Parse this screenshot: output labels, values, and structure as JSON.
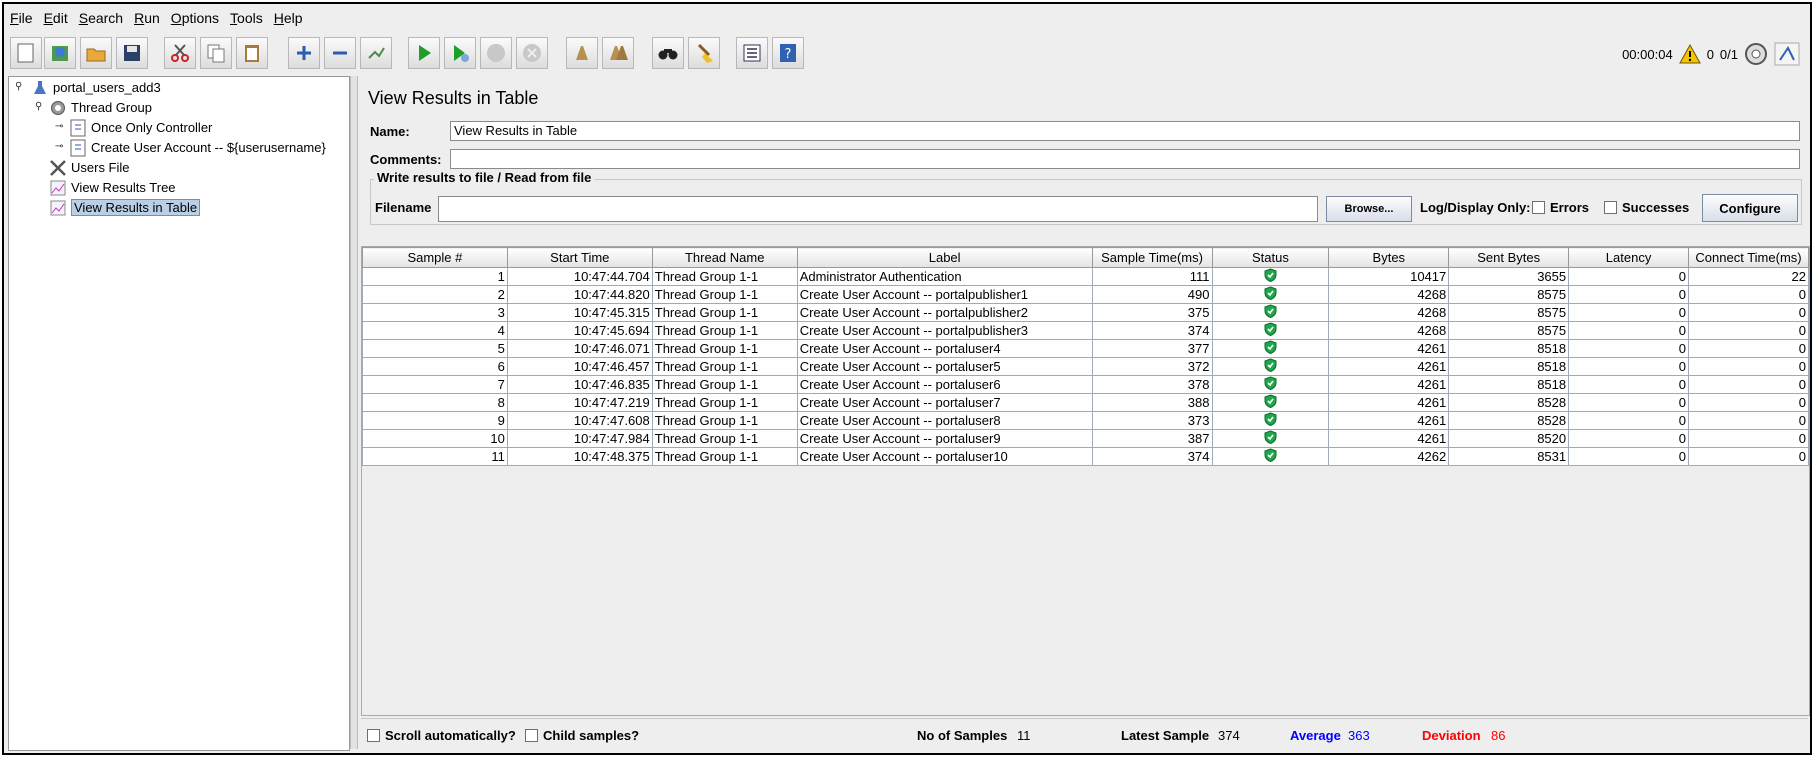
{
  "menu": [
    "File",
    "Edit",
    "Search",
    "Run",
    "Options",
    "Tools",
    "Help"
  ],
  "toolbar": {
    "buttons": [
      "new-icon",
      "templates-icon",
      "open-icon",
      "save-icon",
      "cut-icon",
      "copy-icon",
      "paste-icon",
      "expand-icon",
      "collapse-icon",
      "toggle-icon",
      "start-icon",
      "start-no-pause-icon",
      "stop-icon",
      "shutdown-icon",
      "clear-icon",
      "clear-all-icon",
      "search-icon",
      "reset-search-icon",
      "function-helper-icon",
      "help-icon"
    ],
    "timer": "00:00:04",
    "warnings": "0",
    "threads": "0/1"
  },
  "tree": {
    "items": [
      {
        "label": "portal_users_add3",
        "icon": "test-plan-icon"
      },
      {
        "label": "Thread Group",
        "icon": "thread-group-icon"
      },
      {
        "label": "Once Only Controller",
        "icon": "controller-icon"
      },
      {
        "label": "Create User Account -- ${userusername}",
        "icon": "controller-icon"
      },
      {
        "label": "Users File",
        "icon": "config-icon"
      },
      {
        "label": "View Results Tree",
        "icon": "listener-icon"
      },
      {
        "label": "View Results in Table",
        "icon": "listener-icon"
      }
    ]
  },
  "panel": {
    "title": "View Results in Table",
    "name_label": "Name:",
    "name_value": "View Results in Table",
    "comments_label": "Comments:",
    "comments_value": "",
    "file_group_title": "Write results to file / Read from file",
    "filename_label": "Filename",
    "filename_value": "",
    "browse_label": "Browse...",
    "log_display_label": "Log/Display Only:",
    "errors_label": "Errors",
    "successes_label": "Successes",
    "configure_label": "Configure"
  },
  "table": {
    "columns": [
      "Sample #",
      "Start Time",
      "Thread Name",
      "Label",
      "Sample Time(ms)",
      "Status",
      "Bytes",
      "Sent Bytes",
      "Latency",
      "Connect Time(ms)"
    ],
    "rows": [
      [
        "1",
        "10:47:44.704",
        "Thread Group 1-1",
        "Administrator Authentication",
        "111",
        "success",
        "10417",
        "3655",
        "0",
        "22"
      ],
      [
        "2",
        "10:47:44.820",
        "Thread Group 1-1",
        "Create User Account -- portalpublisher1",
        "490",
        "success",
        "4268",
        "8575",
        "0",
        "0"
      ],
      [
        "3",
        "10:47:45.315",
        "Thread Group 1-1",
        "Create User Account -- portalpublisher2",
        "375",
        "success",
        "4268",
        "8575",
        "0",
        "0"
      ],
      [
        "4",
        "10:47:45.694",
        "Thread Group 1-1",
        "Create User Account -- portalpublisher3",
        "374",
        "success",
        "4268",
        "8575",
        "0",
        "0"
      ],
      [
        "5",
        "10:47:46.071",
        "Thread Group 1-1",
        "Create User Account -- portaluser4",
        "377",
        "success",
        "4261",
        "8518",
        "0",
        "0"
      ],
      [
        "6",
        "10:47:46.457",
        "Thread Group 1-1",
        "Create User Account -- portaluser5",
        "372",
        "success",
        "4261",
        "8518",
        "0",
        "0"
      ],
      [
        "7",
        "10:47:46.835",
        "Thread Group 1-1",
        "Create User Account -- portaluser6",
        "378",
        "success",
        "4261",
        "8518",
        "0",
        "0"
      ],
      [
        "8",
        "10:47:47.219",
        "Thread Group 1-1",
        "Create User Account -- portaluser7",
        "388",
        "success",
        "4261",
        "8528",
        "0",
        "0"
      ],
      [
        "9",
        "10:47:47.608",
        "Thread Group 1-1",
        "Create User Account -- portaluser8",
        "373",
        "success",
        "4261",
        "8528",
        "0",
        "0"
      ],
      [
        "10",
        "10:47:47.984",
        "Thread Group 1-1",
        "Create User Account -- portaluser9",
        "387",
        "success",
        "4261",
        "8520",
        "0",
        "0"
      ],
      [
        "11",
        "10:47:48.375",
        "Thread Group 1-1",
        "Create User Account -- portaluser10",
        "374",
        "success",
        "4262",
        "8531",
        "0",
        "0"
      ]
    ]
  },
  "status": {
    "scroll_label": "Scroll automatically?",
    "child_label": "Child samples?",
    "no_samples_label": "No of Samples",
    "no_samples_value": "11",
    "latest_label": "Latest Sample",
    "latest_value": "374",
    "average_label": "Average",
    "average_value": "363",
    "deviation_label": "Deviation",
    "deviation_value": "86",
    "average_color": "#0000ff",
    "deviation_color": "#ff0000"
  }
}
